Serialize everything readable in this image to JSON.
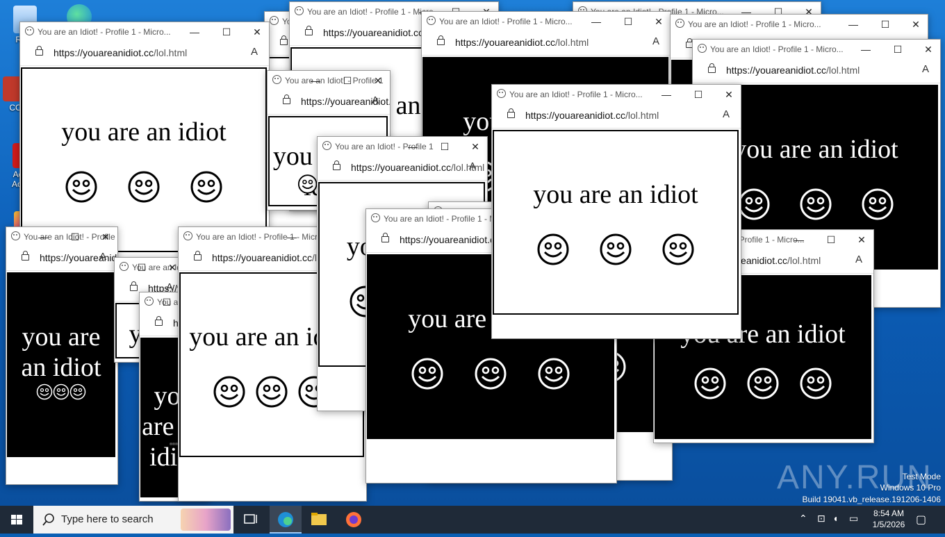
{
  "desktop_icons": [
    {
      "name": "recycle-bin-icon",
      "label": "Recy"
    },
    {
      "name": "ccleaner-icon",
      "label": "CC"
    },
    {
      "name": "adobe-acrobat-icon",
      "label": "Adobe Acroba"
    },
    {
      "name": "edge-desktop-icon",
      "label": ""
    }
  ],
  "browser": {
    "window_title": "You are an Idiot! - Profile 1 - Micro...",
    "window_title_short": "You are an Idiot! - Profile 1",
    "url_host": "https://youareanidiot.cc",
    "url_path": "/lol.html",
    "minimize": "—",
    "maximize": "☐",
    "close": "✕",
    "read_aloud": "A̔"
  },
  "page": {
    "message": "you are an idiot",
    "colors": {
      "white_bg": "#ffffff",
      "black_bg": "#000000"
    }
  },
  "taskbar": {
    "search_placeholder": "Type here to search",
    "time": "8:54 AM",
    "date": "1/5/2026"
  },
  "watermark": {
    "line1": "Test Mode",
    "line2": "Windows 10 Pro",
    "line3": "Build 19041.vb_release.191206-1406",
    "brand": "ANY.RUN"
  }
}
